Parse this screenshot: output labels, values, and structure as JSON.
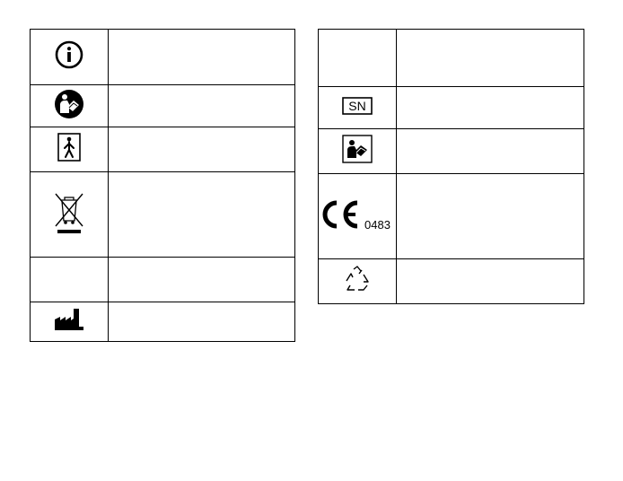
{
  "left_table": {
    "rows": [
      {
        "icon": "info-icon",
        "description": ""
      },
      {
        "icon": "read-manual-mandatory-icon",
        "description": ""
      },
      {
        "icon": "type-bf-applied-part-icon",
        "description": ""
      },
      {
        "icon": "weee-crossed-bin-icon",
        "description": ""
      },
      {
        "icon": "",
        "description": ""
      },
      {
        "icon": "manufacturer-icon",
        "description": ""
      }
    ]
  },
  "right_table": {
    "rows": [
      {
        "icon": "",
        "description": ""
      },
      {
        "icon": "serial-number-icon",
        "label": "SN",
        "description": ""
      },
      {
        "icon": "consult-instructions-icon",
        "description": ""
      },
      {
        "icon": "ce-mark-icon",
        "notified_body": "0483",
        "description": ""
      },
      {
        "icon": "recycle-icon",
        "description": ""
      }
    ]
  }
}
